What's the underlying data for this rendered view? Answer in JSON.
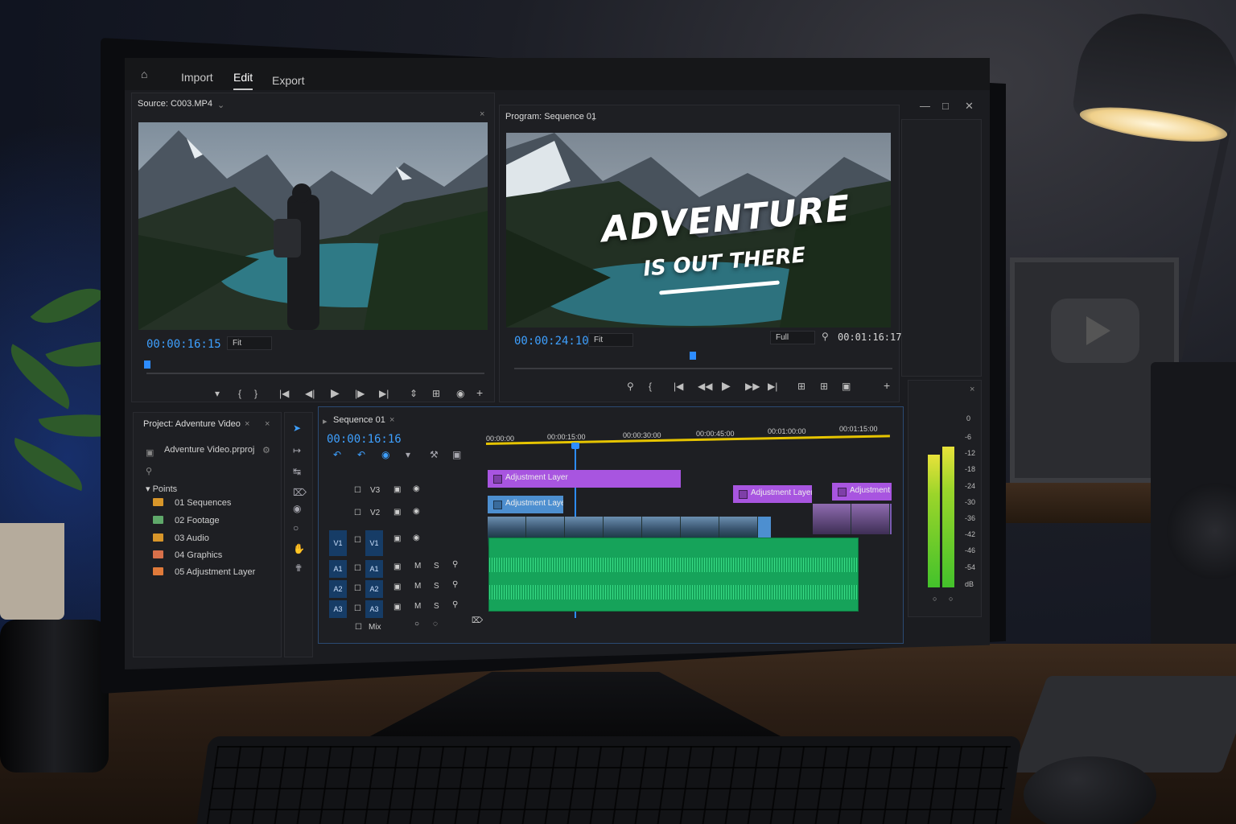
{
  "menu": {
    "import": "Import",
    "edit": "Edit",
    "export": "Export"
  },
  "source": {
    "title": "Source: C003.MP4",
    "timecode": "00:00:16:15",
    "fit": "Fit"
  },
  "program": {
    "title": "Program: Sequence 01",
    "timecode": "00:00:24:10",
    "fit": "Fit",
    "quality": "Full",
    "duration": "00:01:16:17",
    "title_line1": "ADVENTURE",
    "title_line2": "IS OUT THERE"
  },
  "project": {
    "title": "Project: Adventure Video",
    "file": "Adventure Video.prproj",
    "bin_label": "Points",
    "items": [
      {
        "label": "01 Sequences",
        "color": "#d8962a"
      },
      {
        "label": "02 Footage",
        "color": "#5fa86a"
      },
      {
        "label": "03 Audio",
        "color": "#d8962a"
      },
      {
        "label": "04 Graphics",
        "color": "#d8704a"
      },
      {
        "label": "05 Adjustment Layer",
        "color": "#e07a3a"
      }
    ]
  },
  "timeline": {
    "tab": "Sequence 01",
    "timecode": "00:00:16:16",
    "ruler": [
      "00:00:00",
      "00:00:15:00",
      "00:00:30:00",
      "00:00:45:00",
      "00:01:00:00",
      "00:01:15:00"
    ],
    "tracks": {
      "v3": "V3",
      "v2": "V2",
      "v1": "V1",
      "a1": "A1",
      "a2": "A2",
      "a3": "A3",
      "mix": "Mix",
      "m": "M",
      "s": "S"
    },
    "clips": {
      "adj1": "Adjustment Layer",
      "adj2": "Adjustment Layer",
      "adj3": "Adjustment La",
      "adj4": "Adjustment Layer"
    }
  },
  "meters": {
    "labels": [
      "0",
      "-6",
      "-12",
      "-18",
      "-24",
      "-30",
      "-36",
      "-42",
      "-46",
      "-54",
      "dB"
    ]
  },
  "icons": [
    "home-icon",
    "minimize-icon",
    "maximize-icon",
    "close-icon",
    "play-icon",
    "step-back-icon",
    "step-forward-icon",
    "marker-icon",
    "wrench-icon",
    "selection-tool-icon",
    "razor-tool-icon",
    "hand-tool-icon",
    "eye-icon",
    "lock-icon",
    "mic-icon",
    "folder-icon"
  ],
  "colors": {
    "accent": "#2d8cff",
    "adjustment": "#a855e0",
    "video": "#4d8fd0",
    "audio": "#16a35a",
    "work_area": "#e6c400"
  }
}
